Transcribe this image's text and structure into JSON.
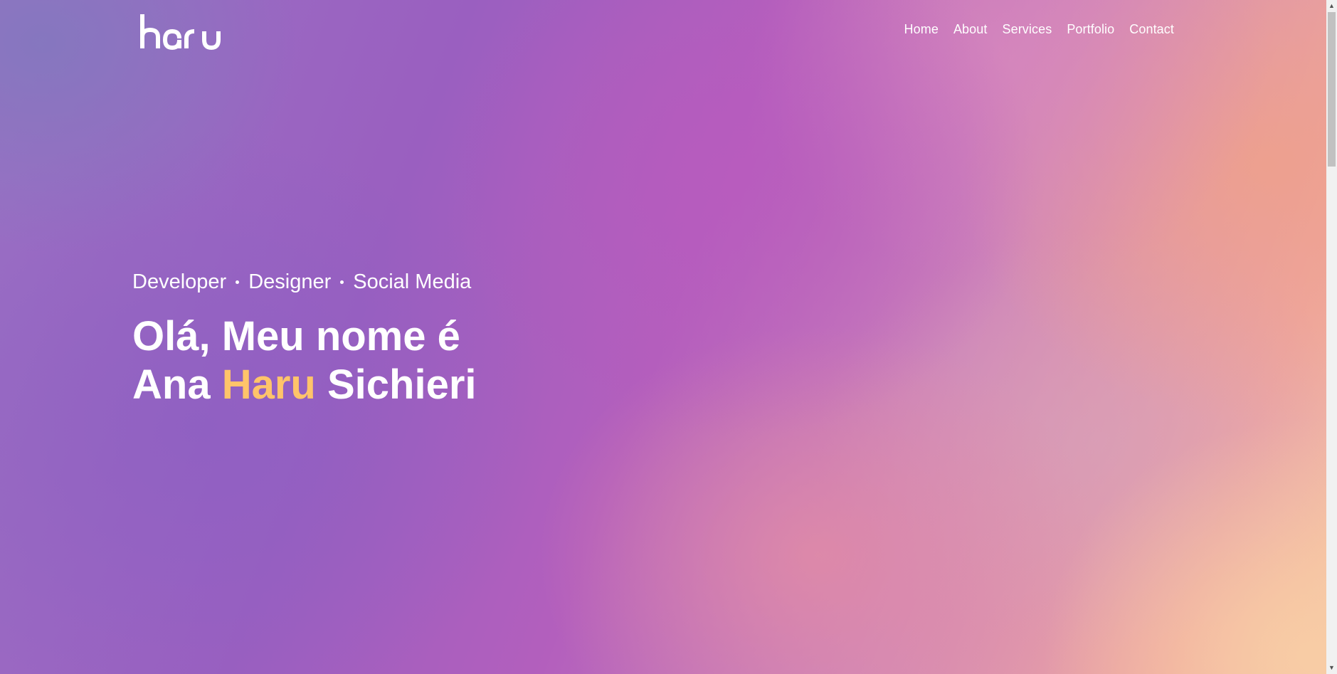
{
  "brand": {
    "logo_text": "haru"
  },
  "nav": {
    "items": [
      {
        "label": "Home"
      },
      {
        "label": "About"
      },
      {
        "label": "Services"
      },
      {
        "label": "Portfolio"
      },
      {
        "label": "Contact"
      }
    ]
  },
  "hero": {
    "roles": [
      "Developer",
      "Designer",
      "Social Media"
    ],
    "line1": "Olá, Meu nome é",
    "first_name": "Ana",
    "highlight_name": "Haru",
    "last_name": "Sichieri"
  },
  "colors": {
    "accent": "#ffc46a",
    "text": "#ffffff"
  },
  "scrollbar": {
    "up_icon": "chevron-up-icon",
    "down_icon": "chevron-down-icon"
  }
}
